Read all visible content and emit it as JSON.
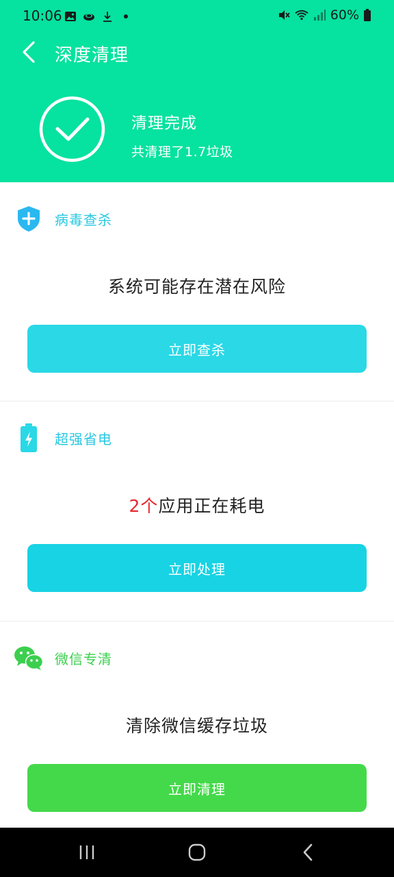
{
  "status_bar": {
    "time": "10:06",
    "battery": "60%",
    "left_icons": [
      "gallery-icon",
      "cloud-icon",
      "download-icon",
      "dot-icon"
    ],
    "right_icons": [
      "mute-icon",
      "wifi-icon",
      "signal-icon",
      "battery-icon"
    ]
  },
  "header": {
    "back_icon": "chevron-left-icon",
    "title": "深度清理",
    "status_title": "清理完成",
    "status_subtitle": "共清理了1.7垃圾",
    "background_color": "#06e29f"
  },
  "cards": [
    {
      "label": "病毒查杀",
      "icon": "shield-plus-icon",
      "label_color": "#28c7e2",
      "message": "系统可能存在潜在风险",
      "button_label": "立即查杀",
      "button_color": "#2ad8e6"
    },
    {
      "label": "超强省电",
      "icon": "battery-bolt-icon",
      "label_color": "#28c7e2",
      "message_highlight": "2个",
      "message": "应用正在耗电",
      "highlight_color": "#e8262d",
      "button_label": "立即处理",
      "button_color": "#17d3e4"
    },
    {
      "label": "微信专清",
      "icon": "wechat-icon",
      "label_color": "#3ccf4f",
      "message": "清除微信缓存垃圾",
      "button_label": "立即清理",
      "button_color": "#44d94a"
    }
  ],
  "navbar": {
    "icons": [
      "recents-icon",
      "home-icon",
      "back-icon"
    ]
  }
}
